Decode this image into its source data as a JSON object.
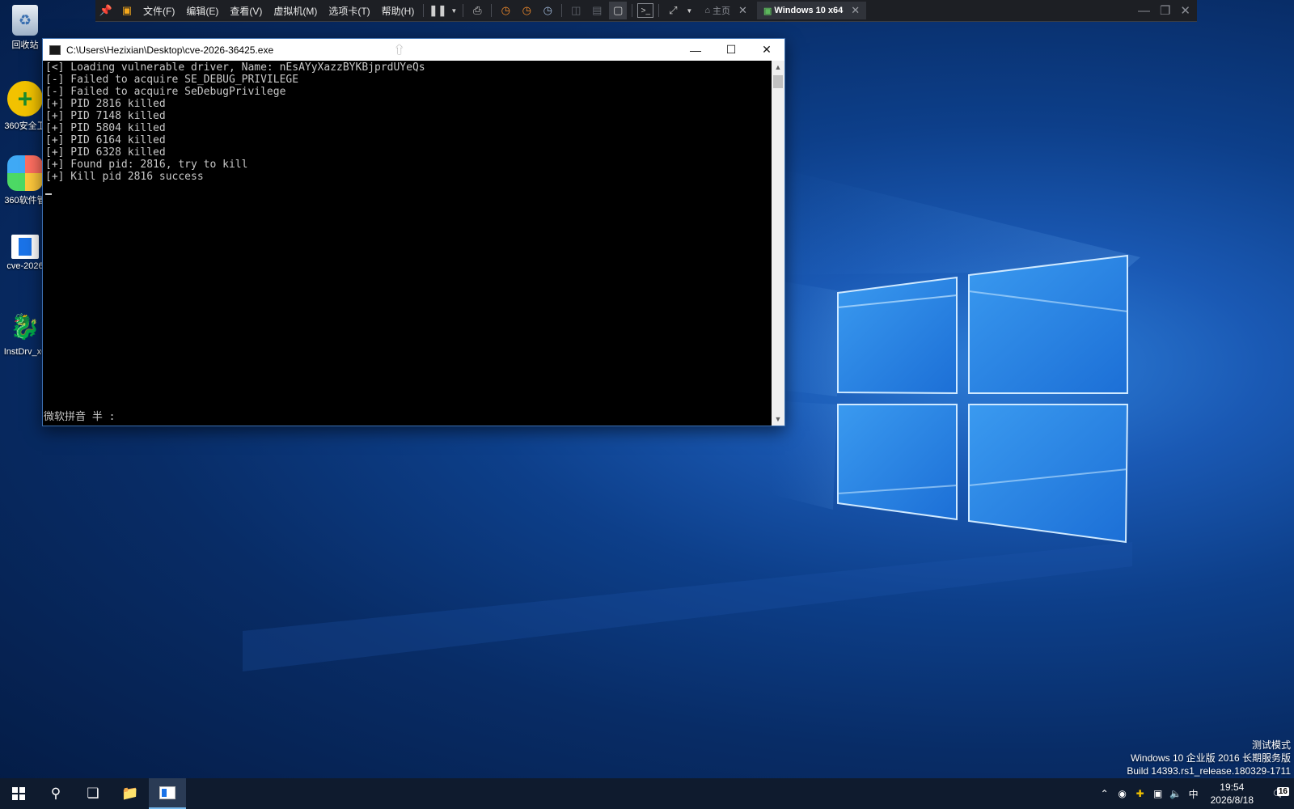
{
  "vm_toolbar": {
    "menus": [
      "文件(F)",
      "编辑(E)",
      "查看(V)",
      "虚拟机(M)",
      "选项卡(T)",
      "帮助(H)"
    ],
    "tab_home": "主页",
    "tab_active": "Windows 10 x64"
  },
  "desktop_icons": [
    {
      "label": "回收站"
    },
    {
      "label": "360安全卫"
    },
    {
      "label": "360软件管"
    },
    {
      "label": "cve-2026"
    },
    {
      "label": "InstDrv_x6"
    }
  ],
  "console": {
    "title": "C:\\Users\\Hezixian\\Desktop\\cve-2026-36425.exe",
    "lines": [
      "[<] Loading vulnerable driver, Name: nEsAYyXazzBYKBjprdUYeQs",
      "[-] Failed to acquire SE_DEBUG_PRIVILEGE",
      "[-] Failed to acquire SeDebugPrivilege",
      "[+] PID 2816 killed",
      "[+] PID 7148 killed",
      "[+] PID 5804 killed",
      "[+] PID 6164 killed",
      "[+] PID 6328 killed",
      "[+] Found pid: 2816, try to kill",
      "[+] Kill pid 2816 success"
    ],
    "ime_status": "微软拼音 半 :"
  },
  "watermark": {
    "line1": "测试模式",
    "line2": "Windows 10 企业版 2016 长期服务版",
    "line3": "Build 14393.rs1_release.180329-1711"
  },
  "taskbar": {
    "time": "19:54",
    "date": "2026/8/18",
    "ime": "中",
    "notification_count": "16"
  }
}
